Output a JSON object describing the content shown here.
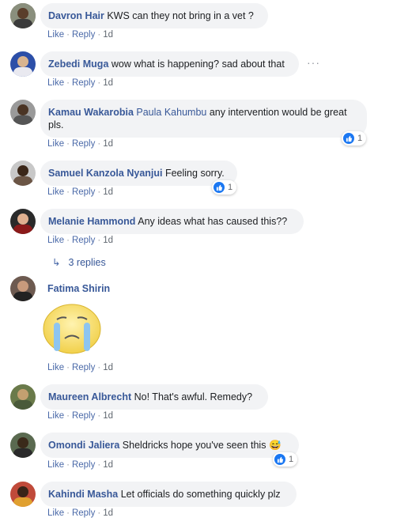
{
  "comments": [
    {
      "author": "Davron Hair",
      "tag": "",
      "text": "KWS can they not bring in a vet ?",
      "like": "Like",
      "reply": "Reply",
      "time": "1d",
      "reactions": ""
    },
    {
      "author": "Zebedi Muga",
      "tag": "",
      "text": "wow what is happening? sad about that",
      "like": "Like",
      "reply": "Reply",
      "time": "1d",
      "reactions": ""
    },
    {
      "author": "Kamau Wakarobia",
      "tag": "Paula Kahumbu",
      "text": "any intervention would be great",
      "text2": "pls.",
      "like": "Like",
      "reply": "Reply",
      "time": "1d",
      "reactions": "1"
    },
    {
      "author": "Samuel Kanzola Nyanjui",
      "tag": "",
      "text": "Feeling sorry.",
      "like": "Like",
      "reply": "Reply",
      "time": "1d",
      "reactions": "1"
    },
    {
      "author": "Melanie Hammond",
      "tag": "",
      "text": "Any ideas what has caused this??",
      "like": "Like",
      "reply": "Reply",
      "time": "1d",
      "reactions": "",
      "replies": "3 replies"
    },
    {
      "author": "Fatima Shirin",
      "tag": "",
      "text": "",
      "like": "Like",
      "reply": "Reply",
      "time": "1d",
      "reactions": "",
      "sticker": "crying-face"
    },
    {
      "author": "Maureen Albrecht",
      "tag": "",
      "text": "No! That's awful. Remedy?",
      "like": "Like",
      "reply": "Reply",
      "time": "1d",
      "reactions": ""
    },
    {
      "author": "Omondi Jaliera",
      "tag": "",
      "text": "Sheldricks hope you've seen this",
      "like": "Like",
      "reply": "Reply",
      "time": "1d",
      "reactions": "1",
      "emoji": "😅"
    },
    {
      "author": "Kahindi Masha",
      "tag": "",
      "text": "Let officials do something quickly plz",
      "like": "Like",
      "reply": "Reply",
      "time": "1d",
      "reactions": ""
    }
  ],
  "colors": {
    "link": "#385898",
    "bubble": "#f2f3f5",
    "like_blue": "#1a77f2"
  }
}
